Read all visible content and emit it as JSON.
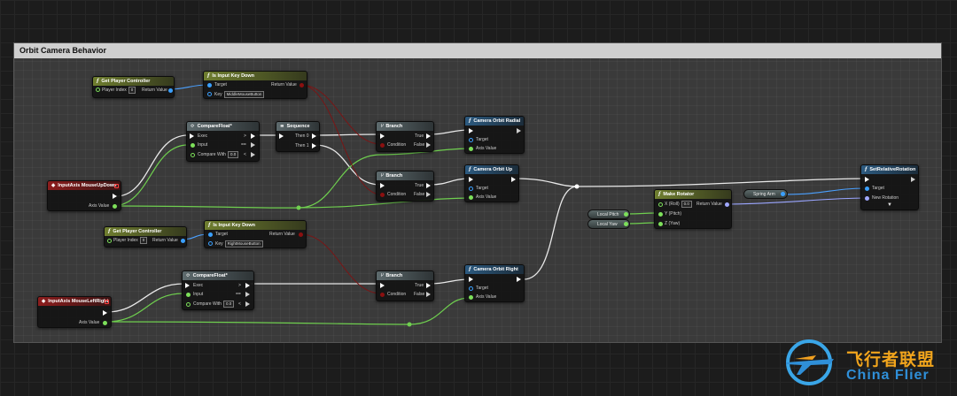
{
  "comment": {
    "title": "Orbit Camera Behavior"
  },
  "nodes": {
    "get_pc1": {
      "title": "Get Player Controller",
      "player_index_label": "Player Index",
      "player_index_value": "0",
      "return_label": "Return Value"
    },
    "iskey1": {
      "title": "Is Input Key Down",
      "target_label": "Target",
      "key_label": "Key",
      "key_value": "MiddleMouseButton",
      "return_label": "Return Value"
    },
    "comp1": {
      "title": "CompareFloat*",
      "exec_label": "Exec",
      "input_label": "Input",
      "compare_label": "Compare With",
      "compare_value": "0.0",
      "gt": ">",
      "eq": "==",
      "lt": "<"
    },
    "seq": {
      "title": "Sequence",
      "then0": "Then 0",
      "then1": "Then 1"
    },
    "branch1": {
      "title": "Branch",
      "condition": "Condition",
      "true": "True",
      "false": "False"
    },
    "branch2": {
      "title": "Branch",
      "condition": "Condition",
      "true": "True",
      "false": "False"
    },
    "branch3": {
      "title": "Branch",
      "condition": "Condition",
      "true": "True",
      "false": "False"
    },
    "radial": {
      "title": "Camera Orbit Radial",
      "target": "Target",
      "axis": "Axis Value"
    },
    "orbitup": {
      "title": "Camera Orbit Up",
      "target": "Target",
      "axis": "Axis Value"
    },
    "orbitright": {
      "title": "Camera Orbit Right",
      "target": "Target",
      "axis": "Axis Value"
    },
    "inputud": {
      "title": "InputAxis MouseUpDown",
      "axis": "Axis Value"
    },
    "inputlr": {
      "title": "InputAxis MouseLeftRight",
      "axis": "Axis Value"
    },
    "get_pc2": {
      "title": "Get Player Controller",
      "player_index_label": "Player Index",
      "player_index_value": "0",
      "return_label": "Return Value"
    },
    "iskey2": {
      "title": "Is Input Key Down",
      "target_label": "Target",
      "key_label": "Key",
      "key_value": "RightMouseButton",
      "return_label": "Return Value"
    },
    "comp2": {
      "title": "CompareFloat*",
      "exec_label": "Exec",
      "input_label": "Input",
      "compare_label": "Compare With",
      "compare_value": "0.0",
      "gt": ">",
      "eq": "==",
      "lt": "<"
    },
    "makerot": {
      "title": "Make Rotator",
      "x_label": "X (Roll)",
      "x_value": "0.0",
      "y_label": "Y (Pitch)",
      "z_label": "Z (Yaw)",
      "return_label": "Return Value"
    },
    "setrel": {
      "title": "SetRelativeRotation",
      "target": "Target",
      "newrot": "New Rotation"
    },
    "local_pitch": {
      "label": "Local Pitch"
    },
    "local_yaw": {
      "label": "Local Yaw"
    },
    "spring_arm": {
      "label": "Spring Arm"
    }
  },
  "watermark": {
    "cn": "飞行者联盟",
    "en": "China Flier"
  },
  "colors": {
    "exec": "#ffffff",
    "float": "#7de05a",
    "object": "#3aa0ff",
    "bool": "#8b1010",
    "struct": "#a0a8ff"
  }
}
